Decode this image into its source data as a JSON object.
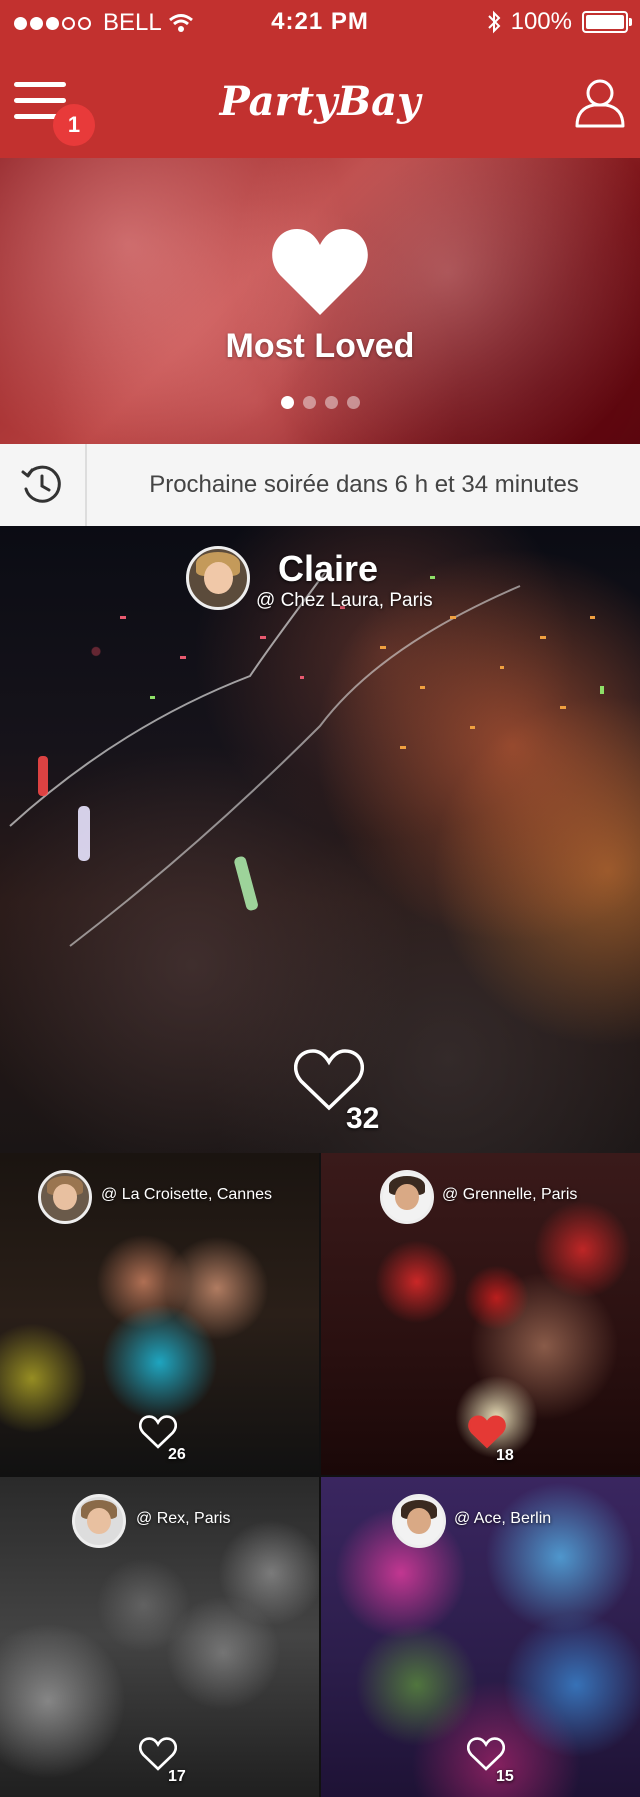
{
  "status_bar": {
    "carrier": "BELL",
    "time": "4:21 PM",
    "battery": "100%"
  },
  "header": {
    "logo": "PartyBay",
    "notification_count": "1"
  },
  "hero": {
    "title": "Most Loved",
    "pages": 4,
    "active_page": 1
  },
  "next_party": {
    "text": "Prochaine soirée dans 6 h et 34 minutes"
  },
  "feed": {
    "featured": {
      "name": "Claire",
      "location": "@ Chez Laura, Paris",
      "likes": "32"
    },
    "posts": [
      {
        "location": "@ La Croisette, Cannes",
        "likes": "26",
        "liked": false
      },
      {
        "location": "@  Grennelle, Paris",
        "likes": "18",
        "liked": true
      },
      {
        "location": "@ Rex, Paris",
        "likes": "17",
        "liked": false
      },
      {
        "location": "@  Ace, Berlin",
        "likes": "15",
        "liked": false
      }
    ]
  },
  "colors": {
    "brand": "#C2312F",
    "heart_liked": "#E53935"
  }
}
